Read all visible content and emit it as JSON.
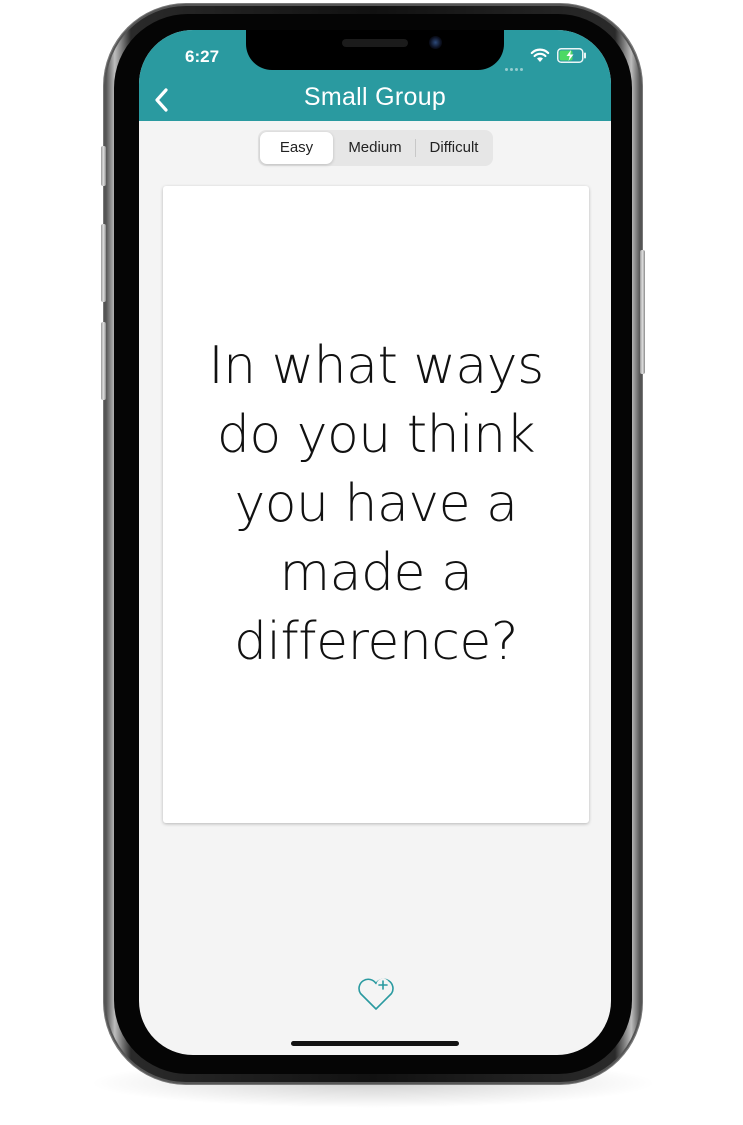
{
  "status_bar": {
    "time": "6:27",
    "icons": [
      "cellular-signal-icon",
      "wifi-icon",
      "battery-charging-icon"
    ]
  },
  "navbar": {
    "title": "Small Group",
    "back_icon": "chevron-left-icon",
    "color": "#2a9aa0"
  },
  "difficulty": {
    "options": [
      "Easy",
      "Medium",
      "Difficult"
    ],
    "selected": "Easy"
  },
  "card": {
    "question": "In what ways do you think you have a made a difference?"
  },
  "footer": {
    "favorite_icon": "heart-plus-icon",
    "accent": "#2a9aa0"
  }
}
